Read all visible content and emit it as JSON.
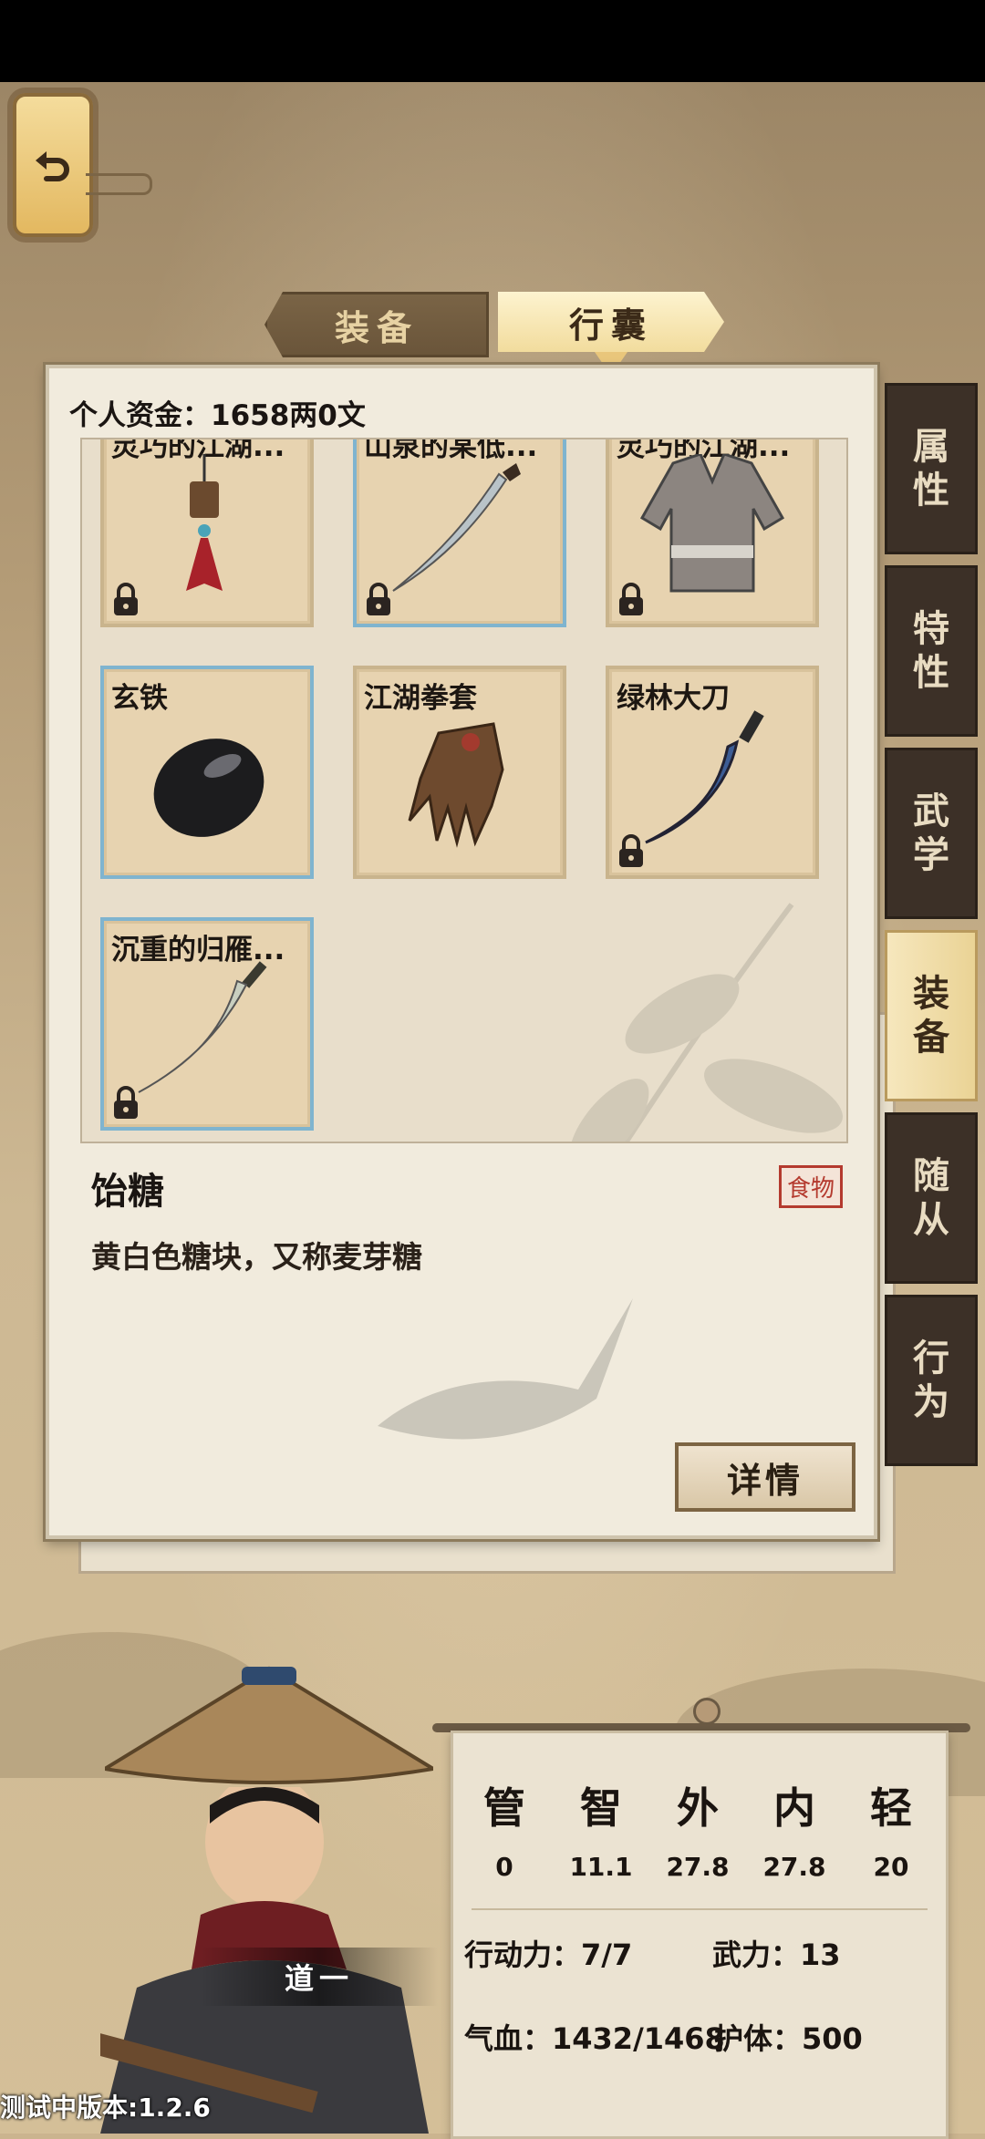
{
  "tabs": {
    "equipment": "装备",
    "bag": "行囊"
  },
  "funds_label": "个人资金：1658两0文",
  "items": [
    {
      "name": "灵巧的江湖...",
      "icon": "pendant-tassel-icon",
      "locked": true,
      "border": "tan"
    },
    {
      "name": "山泉的某低...",
      "icon": "saber-icon",
      "locked": true,
      "border": "blue"
    },
    {
      "name": "灵巧的江湖...",
      "icon": "robe-icon",
      "locked": true,
      "border": "tan"
    },
    {
      "name": "玄铁",
      "icon": "black-iron-ore-icon",
      "locked": false,
      "border": "blue"
    },
    {
      "name": "江湖拳套",
      "icon": "leather-glove-icon",
      "locked": false,
      "border": "tan"
    },
    {
      "name": "绿林大刀",
      "icon": "blue-broadsword-icon",
      "locked": true,
      "border": "tan"
    },
    {
      "name": "沉重的归雁...",
      "icon": "curved-sword-icon",
      "locked": true,
      "border": "blue"
    }
  ],
  "selected": {
    "title": "饴糖",
    "tag": "食物",
    "description": "黄白色糖块，又称麦芽糖",
    "detail_button": "详情"
  },
  "side_tabs": [
    {
      "label_top": "属",
      "label_bottom": "性",
      "active": false
    },
    {
      "label_top": "特",
      "label_bottom": "性",
      "active": false
    },
    {
      "label_top": "武",
      "label_bottom": "学",
      "active": false
    },
    {
      "label_top": "装",
      "label_bottom": "备",
      "active": true
    },
    {
      "label_top": "随",
      "label_bottom": "从",
      "active": false
    },
    {
      "label_top": "行",
      "label_bottom": "为",
      "active": false
    }
  ],
  "character": {
    "name": "道一"
  },
  "stats": {
    "cols": [
      {
        "label": "管",
        "value": "0"
      },
      {
        "label": "智",
        "value": "11.1"
      },
      {
        "label": "外",
        "value": "27.8"
      },
      {
        "label": "内",
        "value": "27.8"
      },
      {
        "label": "轻",
        "value": "20"
      }
    ],
    "action": "行动力：7/7",
    "force": "武力：13",
    "hp": "气血：1432/1468",
    "armor": "护体：500"
  },
  "version": "测试中版本:1.2.6",
  "colors": {
    "accent_gold": "#f2dc9d",
    "dark_tab": "#3c3027",
    "tag_red": "#b43a2e",
    "slot_blue": "#7fb4cf"
  }
}
